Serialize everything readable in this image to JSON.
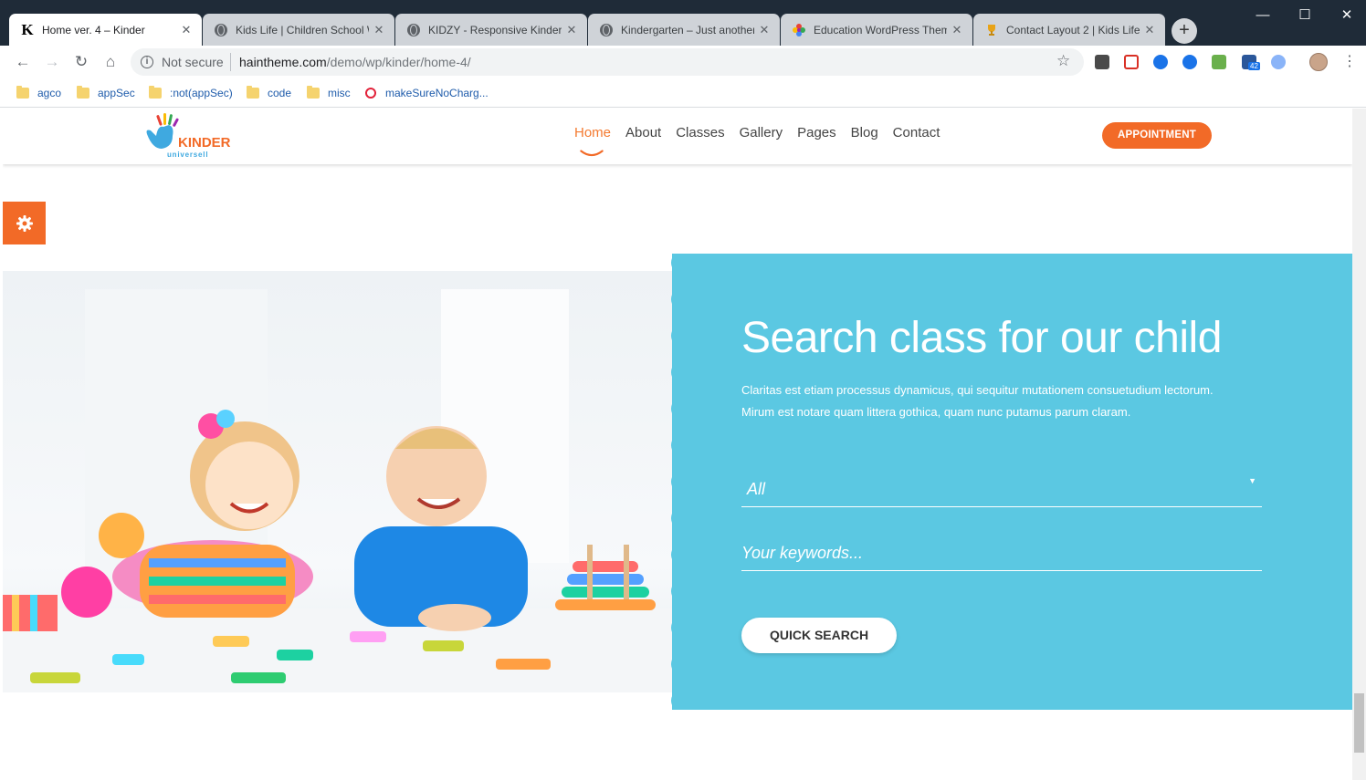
{
  "browser": {
    "tabs": [
      {
        "title": "Home ver. 4 – Kinder",
        "active": true,
        "icon": "kinder-k-icon"
      },
      {
        "title": "Kids Life | Children School W",
        "active": false,
        "icon": "globe-icon"
      },
      {
        "title": "KIDZY - Responsive Kinderg",
        "active": false,
        "icon": "globe-icon"
      },
      {
        "title": "Kindergarten – Just another",
        "active": false,
        "icon": "globe-icon"
      },
      {
        "title": "Education WordPress Them",
        "active": false,
        "icon": "colorful-flower-icon"
      },
      {
        "title": "Contact Layout 2 | Kids Life",
        "active": false,
        "icon": "trophy-icon"
      }
    ],
    "security_label": "Not secure",
    "url_host": "haintheme.com",
    "url_path": "/demo/wp/kinder/home-4/",
    "bookmarks": [
      "agco",
      "appSec",
      ":not(appSec)",
      "code",
      "misc",
      "makeSureNoCharg..."
    ],
    "extension_badge": "42"
  },
  "site": {
    "logo_text": "KINDER",
    "logo_subtext": "universell",
    "nav": [
      "Home",
      "About",
      "Classes",
      "Gallery",
      "Pages",
      "Blog",
      "Contact"
    ],
    "appointment_label": "APPOINTMENT"
  },
  "search_section": {
    "title": "Search class for our child",
    "description_line1": "Claritas est etiam processus dynamicus, qui sequitur mutationem consuetudium lectorum.",
    "description_line2": "Mirum est notare quam littera gothica, quam nunc putamus parum claram.",
    "select_value": "All",
    "keywords_placeholder": "Your keywords...",
    "button_label": "QUICK SEARCH"
  },
  "colors": {
    "accent": "#f26a27",
    "panel_blue": "#5bc8e2",
    "chrome_dark": "#1f2b38"
  }
}
